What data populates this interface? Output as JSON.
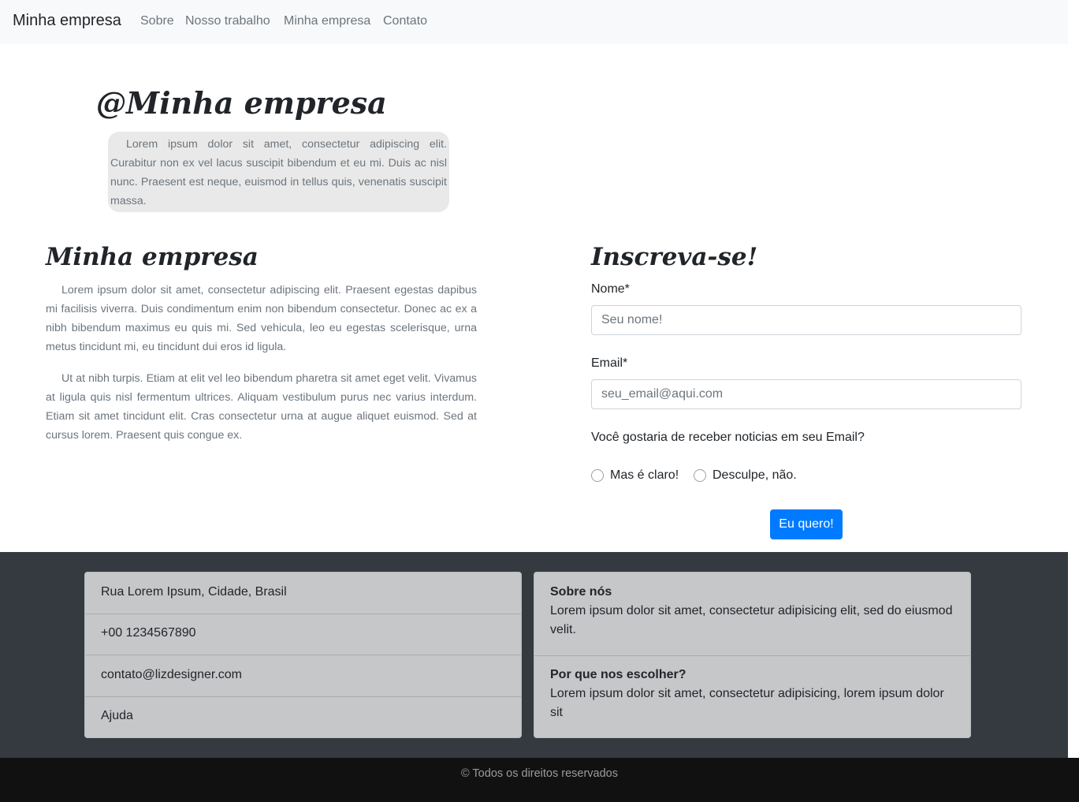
{
  "navbar": {
    "brand": "Minha empresa",
    "links": [
      "Sobre",
      "Nosso trabalho",
      "Minha empresa",
      "Contato"
    ]
  },
  "hero": {
    "title": "@Minha empresa",
    "text": "Lorem ipsum dolor sit amet, consectetur adipiscing elit. Curabitur non ex vel lacus suscipit bibendum et eu mi. Duis ac nisl nunc. Praesent est neque, euismod in tellus quis, venenatis suscipit massa."
  },
  "about": {
    "title": "Minha empresa",
    "paragraphs": [
      "Lorem ipsum dolor sit amet, consectetur adipiscing elit. Praesent egestas dapibus mi facilisis viverra. Duis condimentum enim non bibendum consectetur. Donec ac ex a nibh bibendum maximus eu quis mi. Sed vehicula, leo eu egestas scelerisque, urna metus tincidunt mi, eu tincidunt dui eros id ligula.",
      "Ut at nibh turpis. Etiam at elit vel leo bibendum pharetra sit amet eget velit. Vivamus at ligula quis nisl fermentum ultrices. Aliquam vestibulum purus nec varius interdum. Etiam sit amet tincidunt elit. Cras consectetur urna at augue aliquet euismod. Sed at cursus lorem. Praesent quis congue ex."
    ]
  },
  "signup": {
    "title": "Inscreva-se!",
    "name_label": "Nome*",
    "name_placeholder": "Seu nome!",
    "email_label": "Email*",
    "email_placeholder": "seu_email@aqui.com",
    "question": "Você gostaria de receber noticias em seu Email?",
    "options": [
      "Mas é claro!",
      "Desculpe, não."
    ],
    "submit_label": "Eu quero!"
  },
  "footer": {
    "contact": [
      "Rua Lorem Ipsum, Cidade, Brasil",
      "+00 1234567890",
      "contato@lizdesigner.com",
      "Ajuda"
    ],
    "info": [
      {
        "title": "Sobre nós",
        "text": "Lorem ipsum dolor sit amet, consectetur adipisicing elit, sed do eiusmod velit."
      },
      {
        "title": "Por que nos escolher?",
        "text": "Lorem ipsum dolor sit amet, consectetur adipisicing, lorem ipsum dolor sit"
      }
    ],
    "copyright": "© Todos os direitos reservados"
  },
  "colors": {
    "navbar_bg": "#f8f9fa",
    "primary": "#007bff",
    "footer_bg": "#343a40",
    "card_bg": "#c6c7c9",
    "bottom_bar_bg": "#111111"
  }
}
